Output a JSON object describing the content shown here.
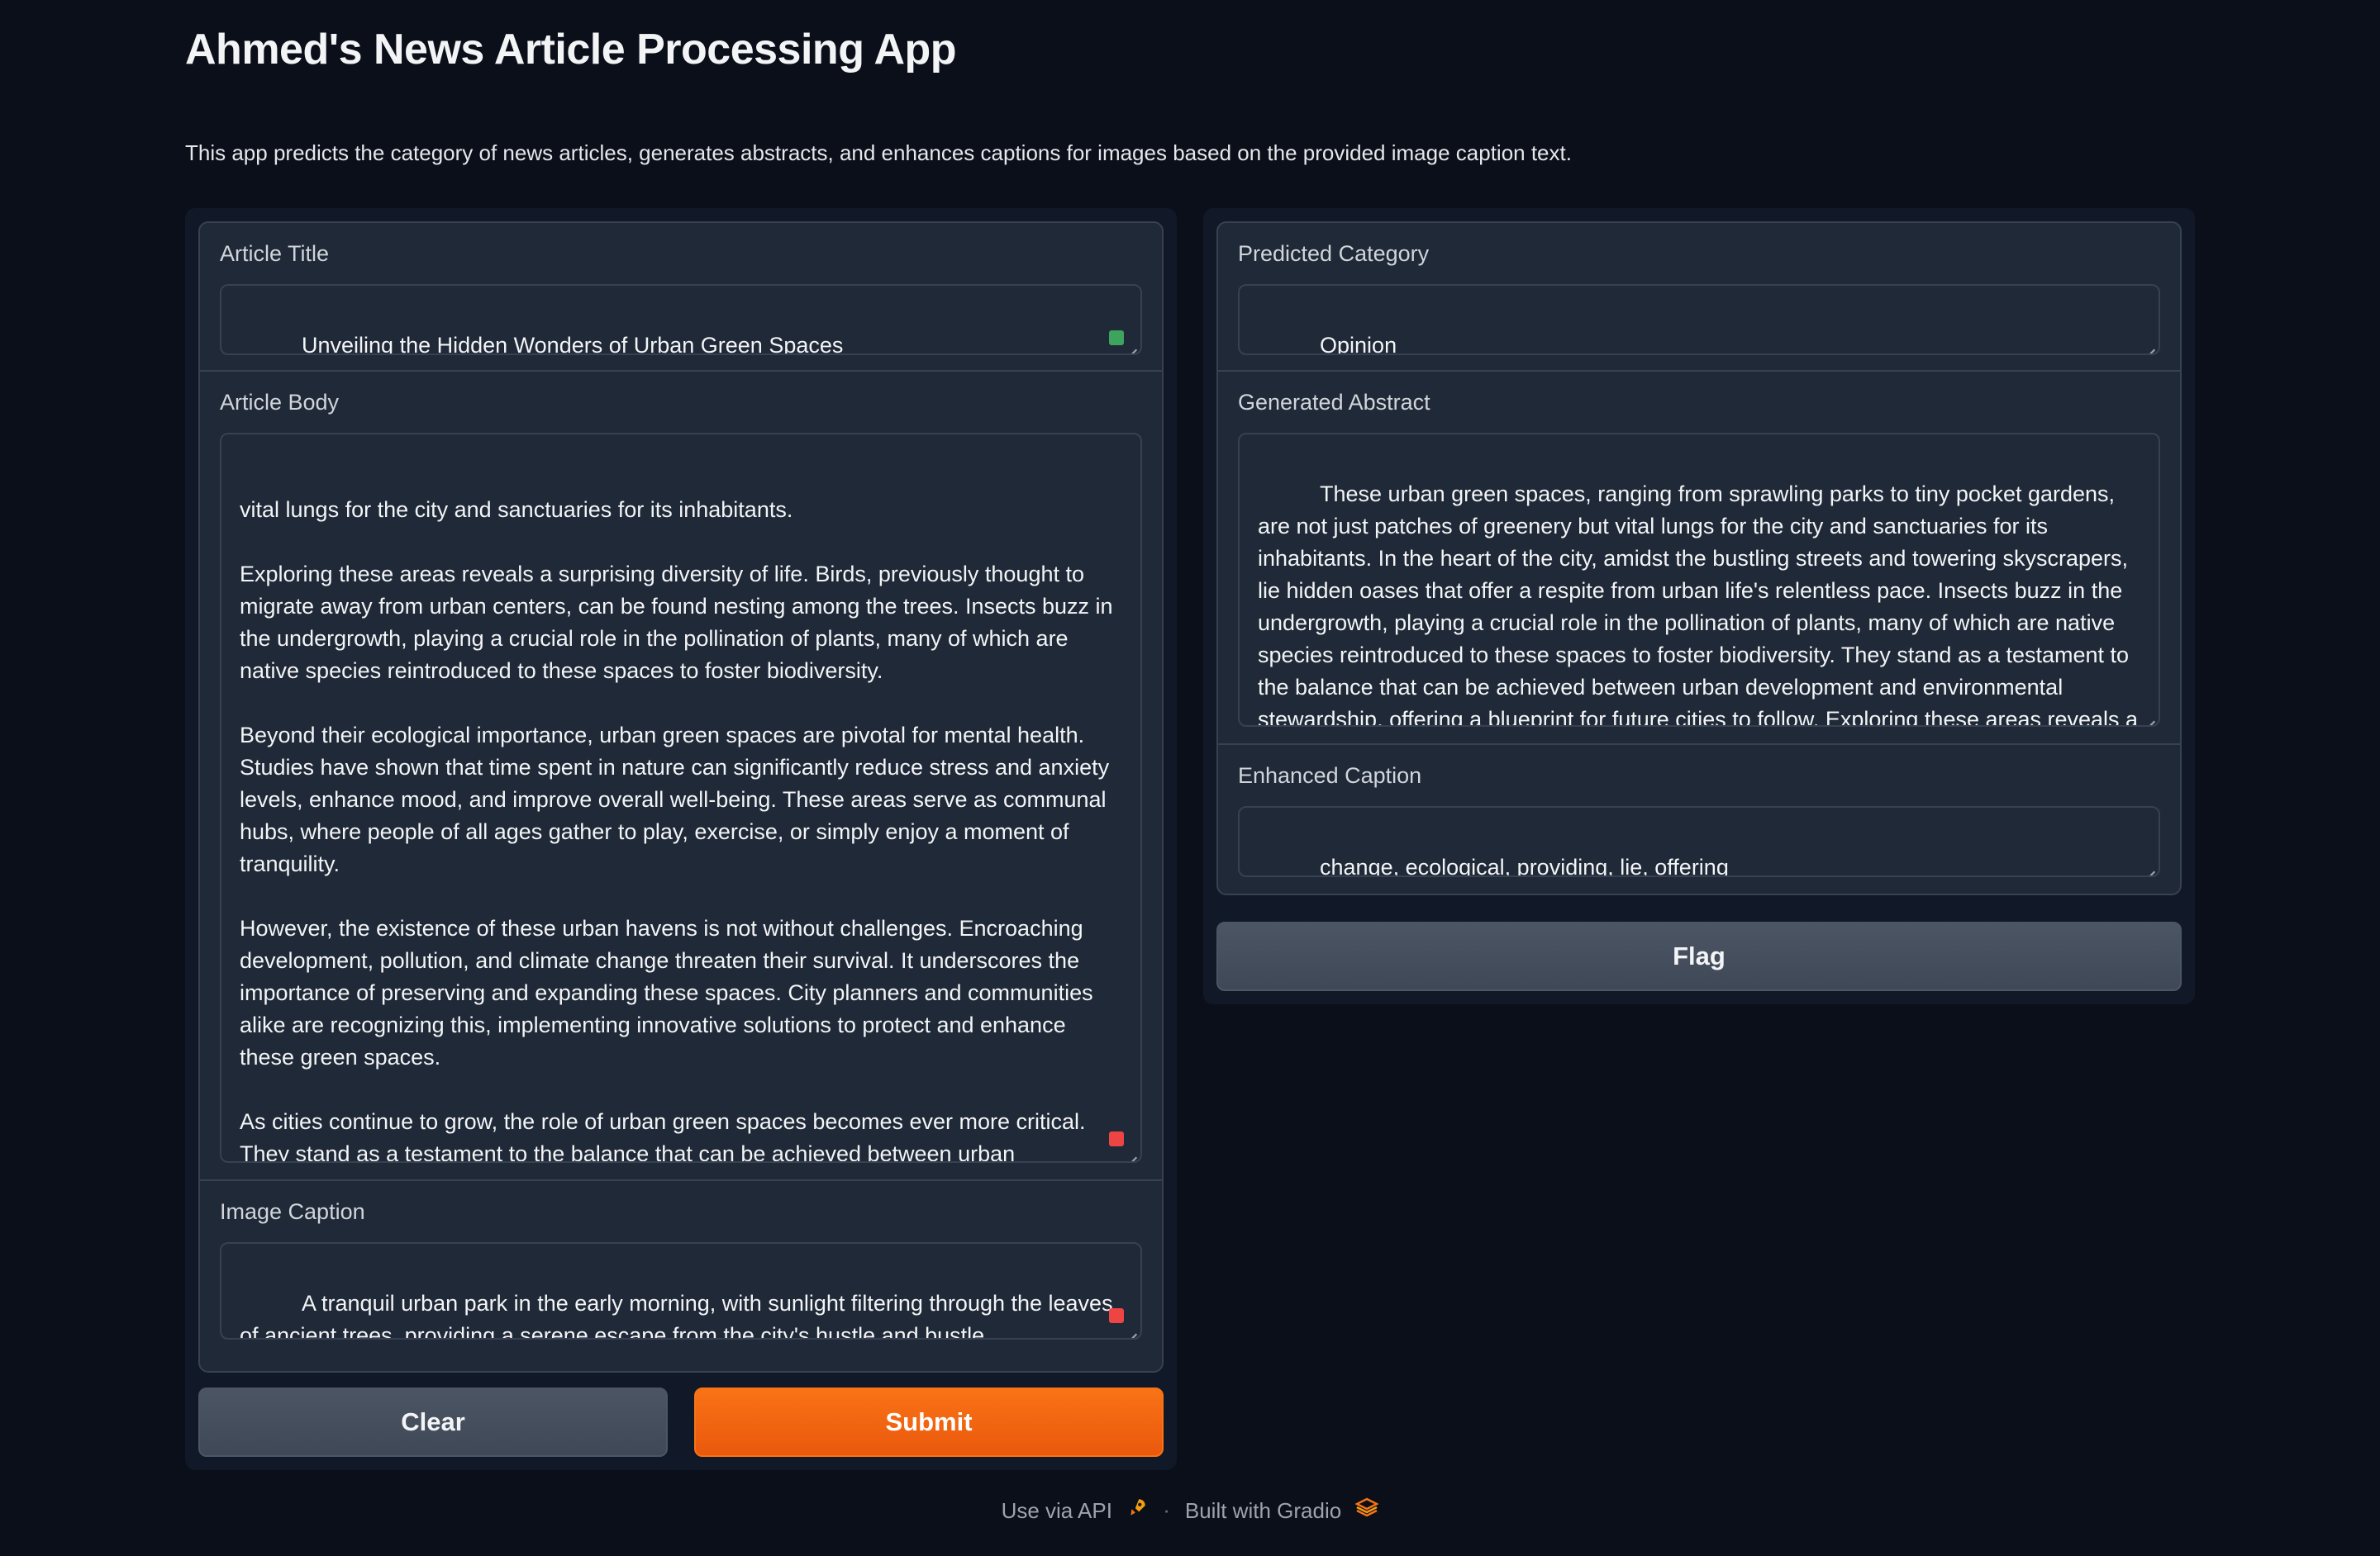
{
  "header": {
    "title": "Ahmed's News Article Processing App",
    "description": "This app predicts the category of news articles, generates abstracts, and enhances captions for images based on the provided image caption text."
  },
  "inputs": {
    "article_title": {
      "label": "Article Title",
      "value": "Unveiling the Hidden Wonders of Urban Green Spaces"
    },
    "article_body": {
      "label": "Article Body",
      "value": "vital lungs for the city and sanctuaries for its inhabitants.\n\nExploring these areas reveals a surprising diversity of life. Birds, previously thought to migrate away from urban centers, can be found nesting among the trees. Insects buzz in the undergrowth, playing a crucial role in the pollination of plants, many of which are native species reintroduced to these spaces to foster biodiversity.\n\nBeyond their ecological importance, urban green spaces are pivotal for mental health. Studies have shown that time spent in nature can significantly reduce stress and anxiety levels, enhance mood, and improve overall well-being. These areas serve as communal hubs, where people of all ages gather to play, exercise, or simply enjoy a moment of tranquility.\n\nHowever, the existence of these urban havens is not without challenges. Encroaching development, pollution, and climate change threaten their survival. It underscores the importance of preserving and expanding these spaces. City planners and communities alike are recognizing this, implementing innovative solutions to protect and enhance these green spaces.\n\nAs cities continue to grow, the role of urban green spaces becomes ever more critical. They stand as a testament to the balance that can be achieved between urban development and environmental stewardship, offering a blueprint for future cities to follow."
    },
    "image_caption": {
      "label": "Image Caption",
      "value_before": "A tranquil urban park in the early morning, with sunlight filtering through the leaves of ancient trees, ",
      "value_misspelled": "providing",
      "value_after": " a serene escape from the city's hustle and bustle"
    },
    "clear_label": "Clear",
    "submit_label": "Submit"
  },
  "outputs": {
    "predicted_category": {
      "label": "Predicted Category",
      "value": "Opinion"
    },
    "generated_abstract": {
      "label": "Generated Abstract",
      "value": "These urban green spaces, ranging from sprawling parks to tiny pocket gardens, are not just patches of greenery but vital lungs for the city and sanctuaries for its inhabitants. In the heart of the city, amidst the bustling streets and towering skyscrapers, lie hidden oases that offer a respite from urban life's relentless pace. Insects buzz in the undergrowth, playing a crucial role in the pollination of plants, many of which are native species reintroduced to these spaces to foster biodiversity. They stand as a testament to the balance that can be achieved between urban development and environmental stewardship, offering a blueprint for future cities to follow. Exploring these areas reveals a surprising diversity of life."
    },
    "enhanced_caption": {
      "label": "Enhanced Caption",
      "value": "change, ecological, providing, lie, offering"
    },
    "flag_label": "Flag"
  },
  "footer": {
    "api_label": "Use via API",
    "separator": "·",
    "built_label": "Built with Gradio"
  },
  "colors": {
    "background": "#0b0f19",
    "panel": "#1f2937",
    "primary": "#f97316",
    "secondary": "#4b5563"
  }
}
